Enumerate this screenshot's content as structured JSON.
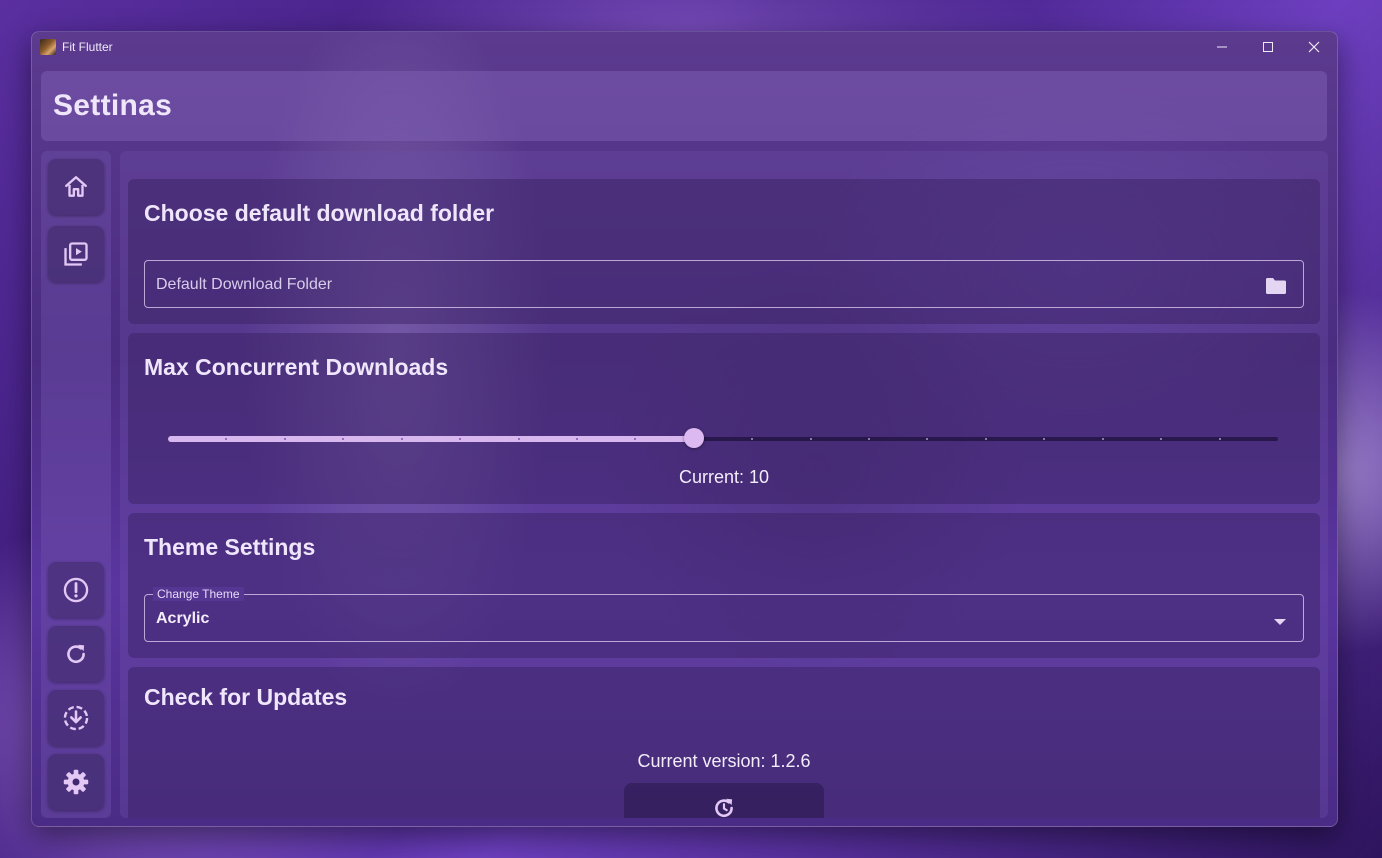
{
  "window": {
    "title": "Fit Flutter",
    "controls": {
      "minimize_icon": "minimize-icon",
      "maximize_icon": "maximize-icon",
      "close_icon": "close-icon"
    }
  },
  "header": {
    "title": "Settinas"
  },
  "sidebar": {
    "top_items": [
      {
        "icon": "home-icon"
      },
      {
        "icon": "video-library-icon"
      }
    ],
    "bottom_items": [
      {
        "icon": "alert-icon"
      },
      {
        "icon": "refresh-icon"
      },
      {
        "icon": "download-circle-icon"
      },
      {
        "icon": "gear-icon"
      }
    ]
  },
  "download_folder": {
    "title": "Choose default download folder",
    "placeholder": "Default Download Folder",
    "icon": "folder-icon"
  },
  "concurrent_downloads": {
    "title": "Max Concurrent Downloads",
    "min": 1,
    "max": 20,
    "value": 10,
    "current_label": "Current: 10"
  },
  "theme": {
    "title": "Theme Settings",
    "field_label": "Change Theme",
    "selected": "Acrylic",
    "dropdown_icon": "dropdown-arrow-icon"
  },
  "updates": {
    "title": "Check for Updates",
    "version_label": "Current version: 1.2.6",
    "button_icon": "update-icon"
  },
  "colors": {
    "accent": "#d8b6ee",
    "text": "#efe6fb"
  }
}
